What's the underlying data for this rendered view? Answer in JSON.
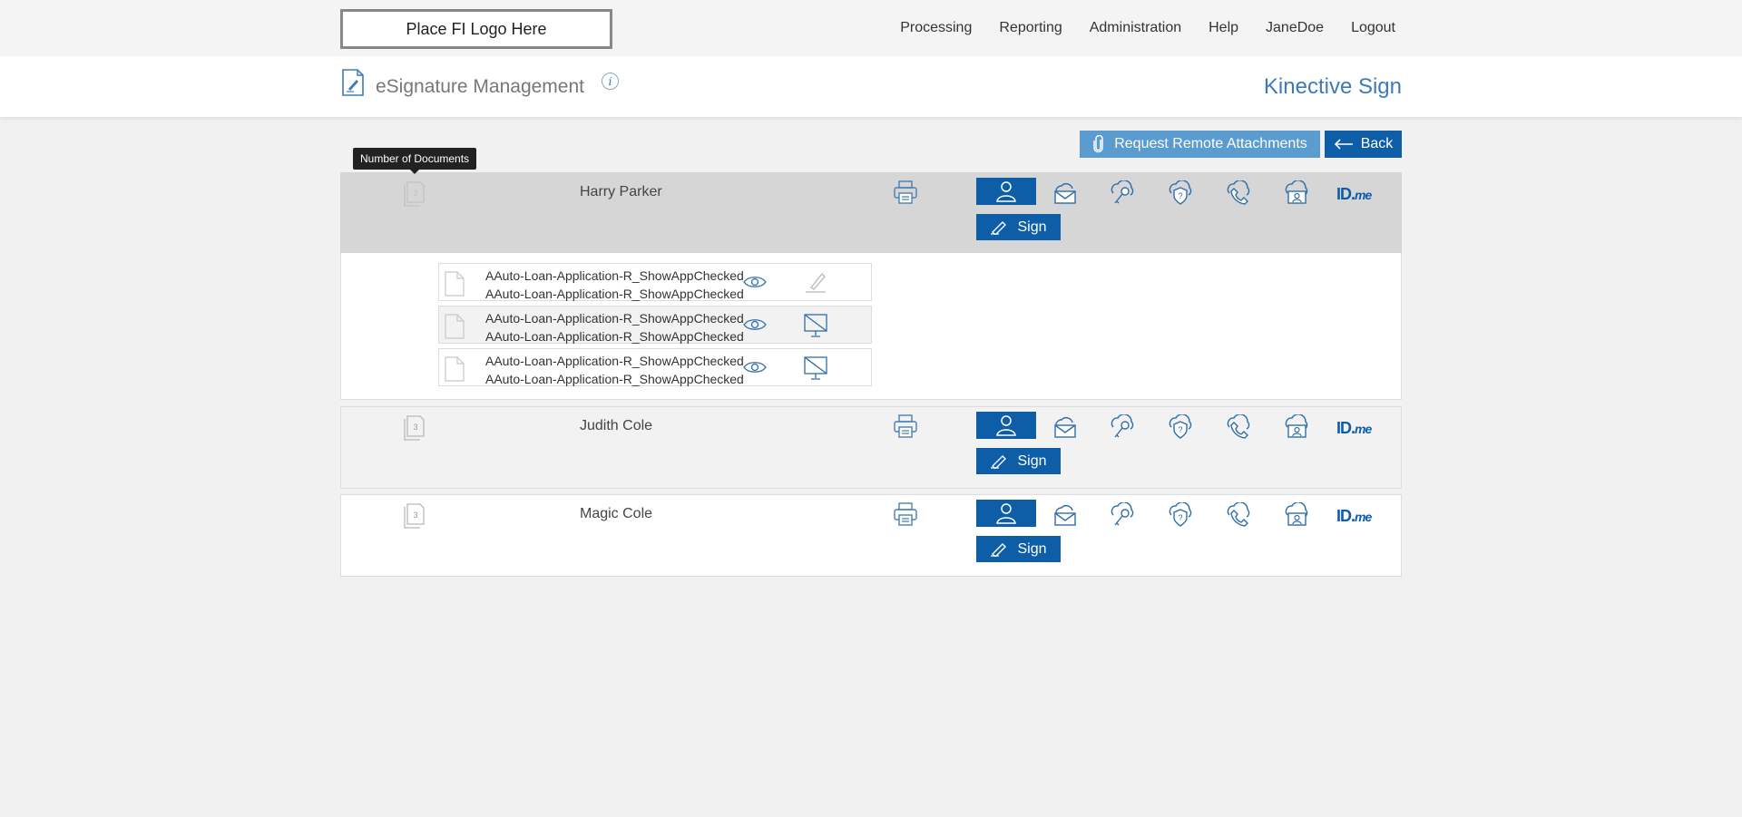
{
  "topbar": {
    "logo_text": "Place FI Logo Here",
    "nav": [
      "Processing",
      "Reporting",
      "Administration",
      "Help",
      "JaneDoe",
      "Logout"
    ]
  },
  "header": {
    "title": "eSignature Management",
    "info": "i",
    "brand": "Kinective Sign"
  },
  "actions": {
    "attach_label": "Request Remote Attachments",
    "back_label": "Back"
  },
  "tooltip": "Number of Documents",
  "signers": [
    {
      "name": "Harry Parker",
      "doc_count": "3",
      "sign_label": "Sign"
    },
    {
      "name": "Judith Cole",
      "doc_count": "3",
      "sign_label": "Sign"
    },
    {
      "name": "Magic Cole",
      "doc_count": "3",
      "sign_label": "Sign"
    }
  ],
  "documents": [
    {
      "line1": "AAuto-Loan-Application-R_ShowAppChecked",
      "line2": "AAuto-Loan-Application-R_ShowAppChecked",
      "action": "sign-pen-icon"
    },
    {
      "line1": "AAuto-Loan-Application-R_ShowAppChecked",
      "line2": "AAuto-Loan-Application-R_ShowAppChecked",
      "action": "no-display-icon"
    },
    {
      "line1": "AAuto-Loan-Application-R_ShowAppChecked",
      "line2": "AAuto-Loan-Application-R_ShowAppChecked",
      "action": "no-display-icon"
    }
  ],
  "idme": {
    "main": "ID.",
    "suffix": "me"
  },
  "colors": {
    "primary": "#0d5ea7",
    "attach": "#5a9bd0",
    "brand": "#3d7ab8",
    "row_active": "#d6d6d6",
    "row_alt": "#f2f2f2"
  }
}
